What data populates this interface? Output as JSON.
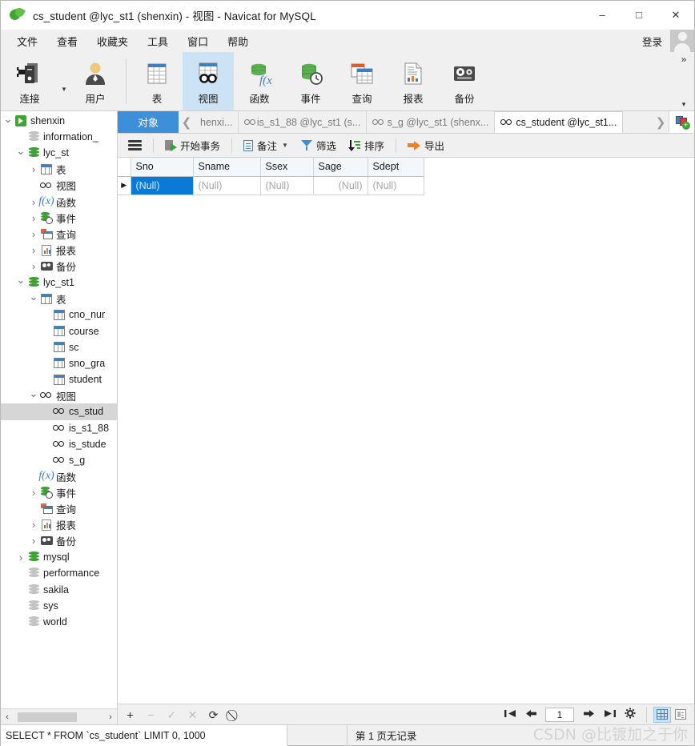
{
  "window": {
    "title": "cs_student @lyc_st1 (shenxin) - 视图 - Navicat for MySQL",
    "minimize": "–",
    "maximize": "□",
    "close": "✕"
  },
  "menubar": {
    "items": [
      "文件",
      "查看",
      "收藏夹",
      "工具",
      "窗口",
      "帮助"
    ],
    "login_label": "登录"
  },
  "ribbon": {
    "buttons": [
      {
        "label": "连接",
        "icon": "connection-icon",
        "has_caret": true,
        "active": false
      },
      {
        "label": "用户",
        "icon": "user-icon",
        "has_caret": false,
        "active": false
      },
      {
        "label": "表",
        "icon": "table-icon",
        "has_caret": false,
        "active": false
      },
      {
        "label": "视图",
        "icon": "view-icon",
        "has_caret": false,
        "active": true
      },
      {
        "label": "函数",
        "icon": "function-icon",
        "has_caret": false,
        "active": false
      },
      {
        "label": "事件",
        "icon": "event-icon",
        "has_caret": false,
        "active": false
      },
      {
        "label": "查询",
        "icon": "query-icon",
        "has_caret": false,
        "active": false
      },
      {
        "label": "报表",
        "icon": "report-icon",
        "has_caret": false,
        "active": false
      },
      {
        "label": "备份",
        "icon": "backup-icon",
        "has_caret": false,
        "active": false
      }
    ],
    "overflow_top": "»",
    "overflow_bottom": "▾"
  },
  "sidebar": {
    "tree": [
      {
        "label": "shenxin",
        "indent": 0,
        "icon": "connection-icon",
        "expander": "down",
        "selected": false
      },
      {
        "label": "information_",
        "indent": 1,
        "icon": "database-gray-icon",
        "expander": "none",
        "selected": false
      },
      {
        "label": "lyc_st",
        "indent": 1,
        "icon": "database-icon",
        "expander": "down",
        "selected": false
      },
      {
        "label": "表",
        "indent": 2,
        "icon": "table-icon",
        "expander": "right",
        "selected": false
      },
      {
        "label": "视图",
        "indent": 2,
        "icon": "view-icon",
        "expander": "none",
        "selected": false
      },
      {
        "label": "函数",
        "indent": 2,
        "icon": "function-icon",
        "expander": "right",
        "selected": false
      },
      {
        "label": "事件",
        "indent": 2,
        "icon": "event-icon",
        "expander": "right",
        "selected": false
      },
      {
        "label": "查询",
        "indent": 2,
        "icon": "query-icon",
        "expander": "right",
        "selected": false
      },
      {
        "label": "报表",
        "indent": 2,
        "icon": "report-icon",
        "expander": "right",
        "selected": false
      },
      {
        "label": "备份",
        "indent": 2,
        "icon": "backup-icon",
        "expander": "right",
        "selected": false
      },
      {
        "label": "lyc_st1",
        "indent": 1,
        "icon": "database-icon",
        "expander": "down",
        "selected": false
      },
      {
        "label": "表",
        "indent": 2,
        "icon": "table-icon",
        "expander": "down",
        "selected": false
      },
      {
        "label": "cno_nur",
        "indent": 3,
        "icon": "table-icon",
        "expander": "none",
        "selected": false
      },
      {
        "label": "course",
        "indent": 3,
        "icon": "table-icon",
        "expander": "none",
        "selected": false
      },
      {
        "label": "sc",
        "indent": 3,
        "icon": "table-icon",
        "expander": "none",
        "selected": false
      },
      {
        "label": "sno_gra",
        "indent": 3,
        "icon": "table-icon",
        "expander": "none",
        "selected": false
      },
      {
        "label": "student",
        "indent": 3,
        "icon": "table-icon",
        "expander": "none",
        "selected": false
      },
      {
        "label": "视图",
        "indent": 2,
        "icon": "view-icon",
        "expander": "down",
        "selected": false
      },
      {
        "label": "cs_stud",
        "indent": 3,
        "icon": "view-icon",
        "expander": "none",
        "selected": true
      },
      {
        "label": "is_s1_88",
        "indent": 3,
        "icon": "view-icon",
        "expander": "none",
        "selected": false
      },
      {
        "label": "is_stude",
        "indent": 3,
        "icon": "view-icon",
        "expander": "none",
        "selected": false
      },
      {
        "label": "s_g",
        "indent": 3,
        "icon": "view-icon",
        "expander": "none",
        "selected": false
      },
      {
        "label": "函数",
        "indent": 2,
        "icon": "function-icon",
        "expander": "none",
        "selected": false
      },
      {
        "label": "事件",
        "indent": 2,
        "icon": "event-icon",
        "expander": "right",
        "selected": false
      },
      {
        "label": "查询",
        "indent": 2,
        "icon": "query-icon",
        "expander": "none",
        "selected": false
      },
      {
        "label": "报表",
        "indent": 2,
        "icon": "report-icon",
        "expander": "right",
        "selected": false
      },
      {
        "label": "备份",
        "indent": 2,
        "icon": "backup-icon",
        "expander": "right",
        "selected": false
      },
      {
        "label": "mysql",
        "indent": 1,
        "icon": "database-icon",
        "expander": "right",
        "selected": false
      },
      {
        "label": "performance",
        "indent": 1,
        "icon": "database-gray-icon",
        "expander": "none",
        "selected": false
      },
      {
        "label": "sakila",
        "indent": 1,
        "icon": "database-gray-icon",
        "expander": "none",
        "selected": false
      },
      {
        "label": "sys",
        "indent": 1,
        "icon": "database-gray-icon",
        "expander": "none",
        "selected": false
      },
      {
        "label": "world",
        "indent": 1,
        "icon": "database-gray-icon",
        "expander": "none",
        "selected": false
      }
    ],
    "hscroll": {
      "left_arrow": "‹",
      "right_arrow": "›"
    }
  },
  "tabbar": {
    "objects_label": "对象",
    "scroll_left": "❮",
    "scroll_right": "❯",
    "tabs": [
      {
        "label": "henxi...",
        "icon": "none",
        "active": false
      },
      {
        "label": "is_s1_88 @lyc_st1 (s...",
        "icon": "view-icon",
        "active": false
      },
      {
        "label": "s_g @lyc_st1 (shenx...",
        "icon": "view-icon",
        "active": false
      },
      {
        "label": "cs_student @lyc_st1...",
        "icon": "view-icon",
        "active": true
      }
    ],
    "add_tab_icon": "new-query-icon"
  },
  "actiontoolbar": {
    "menu_icon": "hamburger-icon",
    "buttons": [
      {
        "label": "开始事务",
        "icon": "transaction-icon",
        "caret": false
      },
      {
        "label": "备注",
        "icon": "note-icon",
        "caret": true
      },
      {
        "label": "筛选",
        "icon": "filter-icon",
        "caret": false
      },
      {
        "label": "排序",
        "icon": "sort-icon",
        "caret": false
      },
      {
        "label": "导出",
        "icon": "export-icon",
        "caret": false
      }
    ]
  },
  "grid": {
    "columns": [
      "Sno",
      "Sname",
      "Ssex",
      "Sage",
      "Sdept"
    ],
    "rows": [
      {
        "marker": "▶",
        "cells": [
          "(Null)",
          "(Null)",
          "(Null)",
          "(Null)",
          "(Null)"
        ],
        "selected_col": 0
      }
    ]
  },
  "editbar": {
    "add": "+",
    "remove": "−",
    "confirm": "✓",
    "cancel": "✕",
    "refresh": "⟳",
    "stop": "⃠"
  },
  "pager": {
    "first": "⮜❘",
    "prev": "⬅",
    "page_value": "1",
    "next": "➡",
    "last": "❘⮞",
    "settings": "⚙",
    "grid_view_icon": "grid-view-icon",
    "form_view_icon": "form-view-icon"
  },
  "statusbar": {
    "sql": "SELECT * FROM `cs_student` LIMIT 0, 1000",
    "page_info": "第 1 页无记录",
    "watermark": "CSDN @比镀加之于你"
  },
  "colors": {
    "accent": "#3c8fd8",
    "selection": "#0b7ad6",
    "ribbon_active": "#cce3f6",
    "chrome": "#f0f0f0"
  }
}
